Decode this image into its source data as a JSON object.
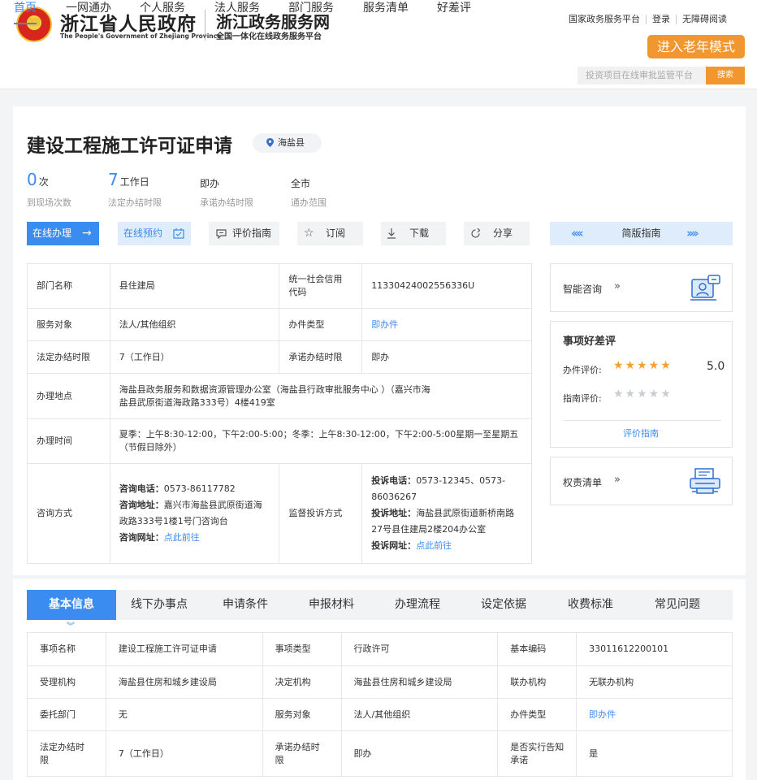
{
  "header": {
    "gov_name": "浙江省人民政府",
    "gov_name_en": "The People's Government of Zhejiang Province",
    "site_name": "浙江政务服务网",
    "site_sub": "全国一体化在线政务服务平台",
    "top_links": [
      "国家政务服务平台",
      "登录",
      "无障碍阅读"
    ],
    "elder_mode": "进入老年模式",
    "nav": [
      "首页",
      "一网通办",
      "个人服务",
      "法人服务",
      "部门服务",
      "服务清单",
      "好差评"
    ],
    "search_placeholder": "投资项目在线审批监管平台",
    "search_button": "搜索"
  },
  "item": {
    "title": "建设工程施工许可证申请",
    "location": "海盐县",
    "stats": [
      {
        "num": "0",
        "unit": "次",
        "label": "到现场次数"
      },
      {
        "num": "7",
        "unit": "工作日",
        "label": "法定办结时限"
      },
      {
        "value": "即办",
        "label": "承诺办结时限"
      },
      {
        "value": "全市",
        "label": "通办范围"
      }
    ],
    "buttons": {
      "online": "在线办理",
      "reserve": "在线预约",
      "evaluate": "评价指南",
      "subscribe": "订阅",
      "download": "下载",
      "share": "分享",
      "simple_guide": "简版指南"
    }
  },
  "info": {
    "dept_k": "部门名称",
    "dept_v": "县住建局",
    "credit_k": "统一社会信用代码",
    "credit_v": "11330424002556336U",
    "target_k": "服务对象",
    "target_v": "法人/其他组织",
    "type_k": "办件类型",
    "type_v": "即办件",
    "legal_k": "法定办结时限",
    "legal_v": "7（工作日）",
    "promise_k": "承诺办结时限",
    "promise_v": "即办",
    "addr_k": "办理地点",
    "addr_v": "海盐县政务服务和数据资源管理办公室（海盐县行政审批服务中心 ）（嘉兴市海盐县武原街道海政路333号）4楼419室",
    "time_k": "办理时间",
    "time_v": "夏季：上午8:30-12:00，下午2:00-5:00；冬季：上午8:30-12:00，下午2:00-5:00星期一至星期五（节假日除外）",
    "consult_k": "咨询方式",
    "consult_phone_k": "咨询电话：",
    "consult_phone_v": "0573-86117782",
    "consult_addr_k": "咨询地址：",
    "consult_addr_v": "嘉兴市海盐县武原街道海政路333号1楼1号门咨询台",
    "consult_web_k": "咨询网址：",
    "consult_web_v": "点此前往",
    "complain_k": "监督投诉方式",
    "complain_phone_k": "投诉电话：",
    "complain_phone_v": "0573-12345、0573-86036267",
    "complain_addr_k": "投诉地址：",
    "complain_addr_v": "海盐县武原街道新桥南路27号县住建局2楼204办公室",
    "complain_web_k": "投诉网址：",
    "complain_web_v": "点此前往"
  },
  "side": {
    "consult": "智能咨询",
    "review_title": "事项好差评",
    "handle_label": "办件评价:",
    "handle_score": "5.0",
    "handle_stars": 5,
    "guide_label": "指南评价:",
    "guide_stars": 0,
    "review_link": "评价指南",
    "rights": "权责清单"
  },
  "tabs": [
    "基本信息",
    "线下办事点",
    "申请条件",
    "申报材料",
    "办理流程",
    "设定依据",
    "收费标准",
    "常见问题"
  ],
  "basic": [
    [
      "事项名称",
      "建设工程施工许可证申请",
      "事项类型",
      "行政许可",
      "基本编码",
      "33011612200101"
    ],
    [
      "受理机构",
      "海盐县住房和城乡建设局",
      "决定机构",
      "海盐县住房和城乡建设局",
      "联办机构",
      "无联办机构"
    ],
    [
      "委托部门",
      "无",
      "服务对象",
      "法人/其他组织",
      "办件类型",
      "即办件"
    ],
    [
      "法定办结时限",
      "7（工作日）",
      "承诺办结时限",
      "即办",
      "是否实行告知承诺",
      "是"
    ]
  ],
  "colors": {
    "accent": "#3b8cf0",
    "orange": "#f2962f",
    "star": "#f5a030"
  }
}
